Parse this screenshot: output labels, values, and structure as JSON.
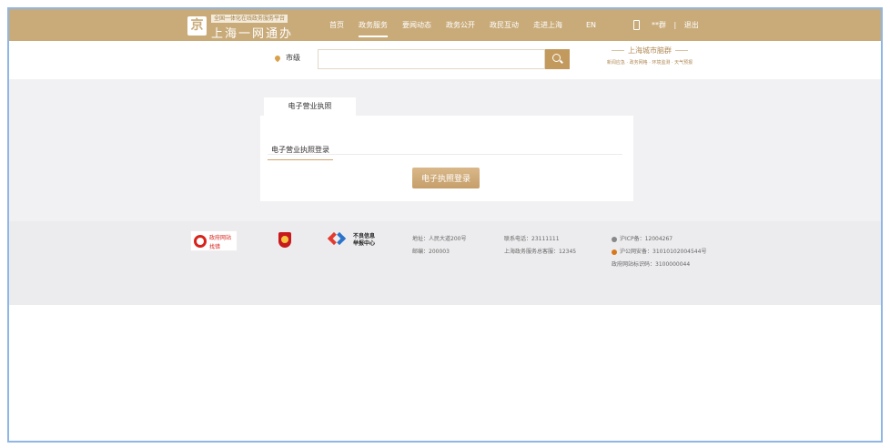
{
  "header": {
    "logo_badge": "京",
    "logo_slogan": "全国一体化在线政务服务平台",
    "logo_title": "上海一网通办",
    "nav": [
      "首页",
      "政务服务",
      "要闻动态",
      "政务公开",
      "政民互动",
      "走进上海"
    ],
    "active_nav": "政务服务",
    "lang": "EN",
    "user": "**群",
    "separator": "|",
    "logout": "退出"
  },
  "search": {
    "region": "市级",
    "placeholder": "",
    "city_brain_title": "上海城市脑群",
    "city_brain_links": "新闻应急 · 政务网格 · 环境监测 · 天气预报"
  },
  "main": {
    "tab": "电子营业执照",
    "subtab": "电子营业执照登录",
    "login_button": "电子执照登录"
  },
  "footer": {
    "find_error_line1": "政府网站",
    "find_error_line2": "找错",
    "report_line1": "不良信息",
    "report_line2": "举报中心",
    "address": "地址：人民大道200号",
    "postcode": "邮编：200003",
    "phone": "联系电话：23111111",
    "hotline": "上海政务服务总客服：12345",
    "icp": "沪ICP备：12004267",
    "police": "沪公网安备：31010102004544号",
    "site_code": "政府网站标识码：3100000044"
  },
  "colors": {
    "header": "#c9ab7a",
    "accent": "#c39a5e",
    "frame": "#8fb6e6"
  }
}
